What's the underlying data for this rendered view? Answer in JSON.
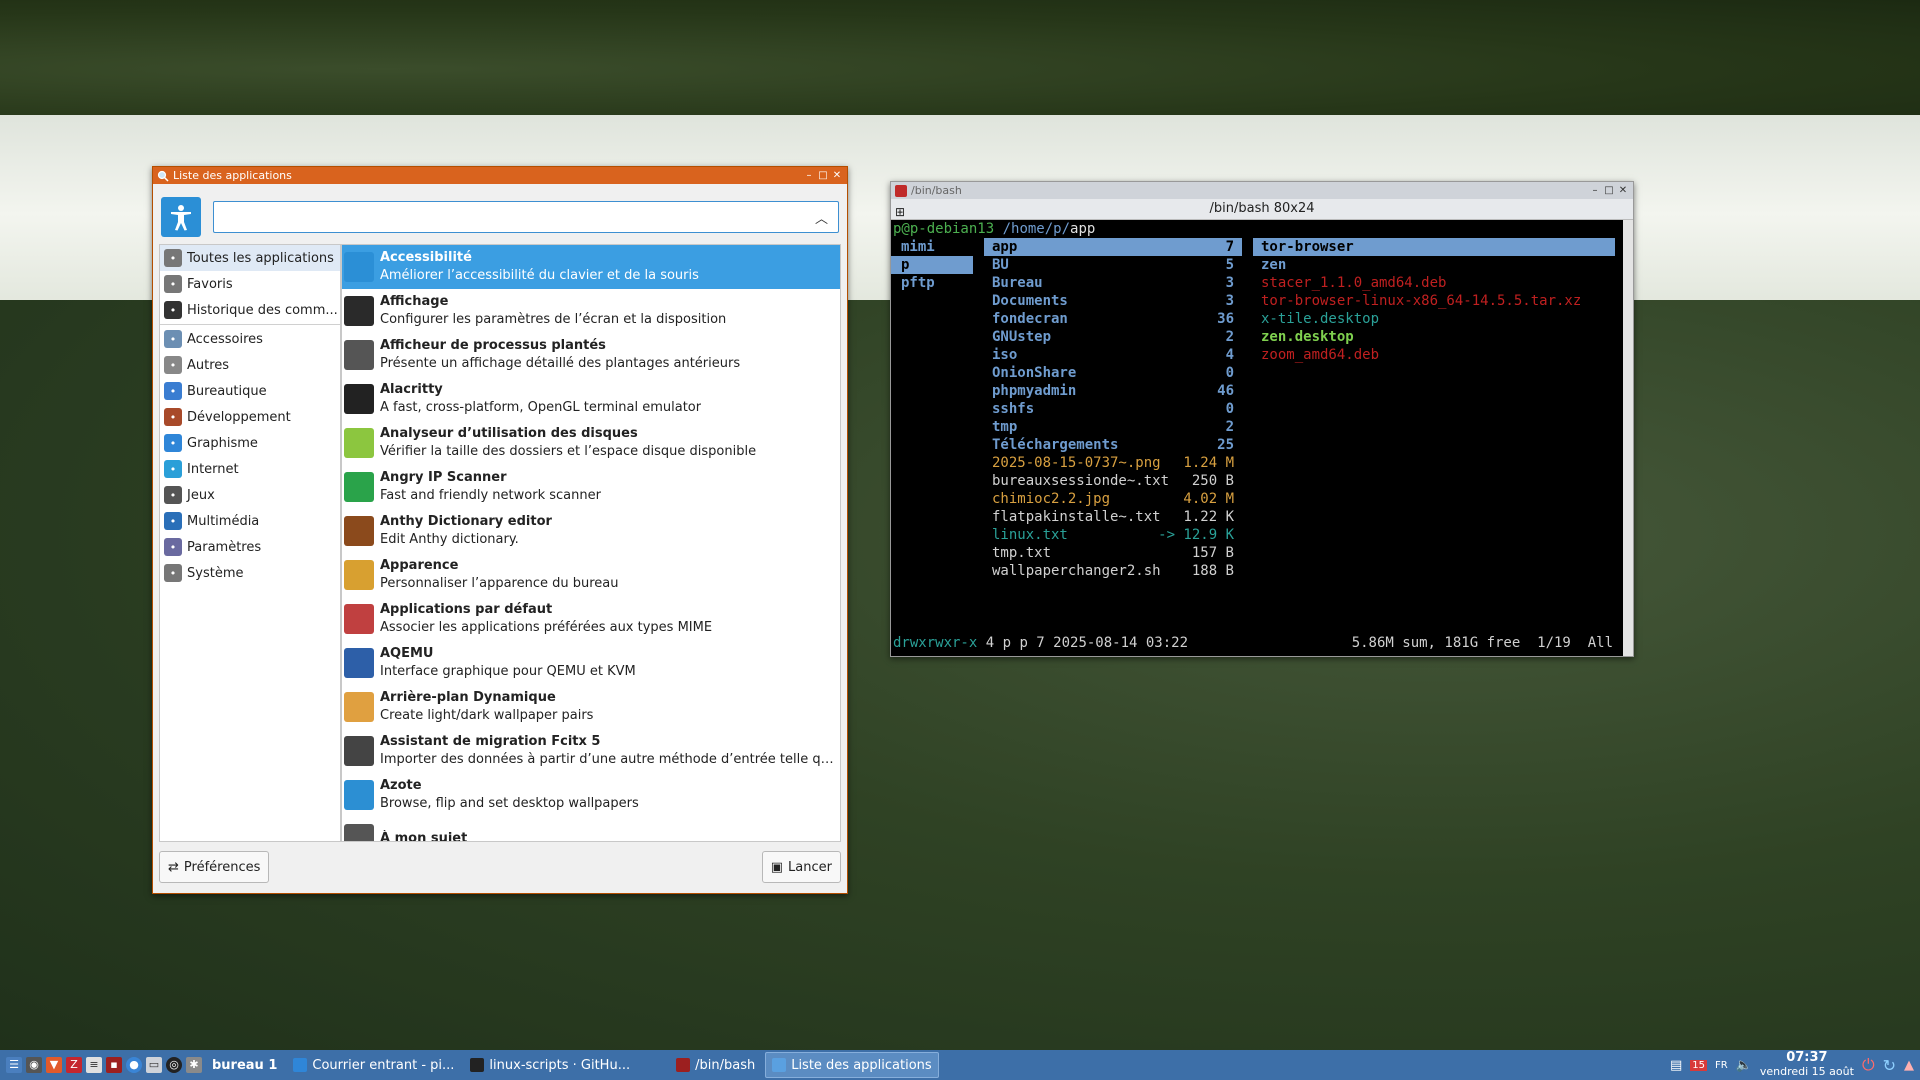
{
  "colors": {
    "accent": "#3b9ee2",
    "titlebar_active": "#d9631e",
    "taskbar": "#3d6fa8",
    "term_green": "#4cb050",
    "term_blue": "#6f9ccf",
    "term_orange": "#d8a040",
    "term_red": "#c02020",
    "term_teal": "#2aa198"
  },
  "applist": {
    "title": "Liste des applications",
    "search_value": "",
    "categories_top": [
      {
        "label": "Toutes les applications",
        "icon": "all-apps-icon"
      },
      {
        "label": "Favoris",
        "icon": "favorites-icon"
      },
      {
        "label": "Historique des comm...",
        "icon": "history-icon"
      }
    ],
    "categories": [
      {
        "label": "Accessoires",
        "icon": "accessories-icon"
      },
      {
        "label": "Autres",
        "icon": "others-icon"
      },
      {
        "label": "Bureautique",
        "icon": "office-icon"
      },
      {
        "label": "Développement",
        "icon": "development-icon"
      },
      {
        "label": "Graphisme",
        "icon": "graphics-icon"
      },
      {
        "label": "Internet",
        "icon": "internet-icon"
      },
      {
        "label": "Jeux",
        "icon": "games-icon"
      },
      {
        "label": "Multimédia",
        "icon": "multimedia-icon"
      },
      {
        "label": "Paramètres",
        "icon": "settings-icon"
      },
      {
        "label": "Système",
        "icon": "system-icon"
      }
    ],
    "apps": [
      {
        "name": "Accessibilité",
        "desc": "Améliorer l’accessibilité du clavier et de la souris",
        "icon": "accessibility-icon"
      },
      {
        "name": "Affichage",
        "desc": "Configurer les paramètres de l’écran et la disposition",
        "icon": "display-icon"
      },
      {
        "name": "Afficheur de processus plantés",
        "desc": "Présente un affichage détaillé des plantages antérieurs",
        "icon": "crash-viewer-icon"
      },
      {
        "name": "Alacritty",
        "desc": "A fast, cross-platform, OpenGL terminal emulator",
        "icon": "alacritty-icon"
      },
      {
        "name": "Analyseur d’utilisation des disques",
        "desc": "Vérifier la taille des dossiers et l’espace disque disponible",
        "icon": "disk-usage-icon"
      },
      {
        "name": "Angry IP Scanner",
        "desc": "Fast and friendly network scanner",
        "icon": "ip-scanner-icon"
      },
      {
        "name": "Anthy Dictionary editor",
        "desc": "Edit Anthy dictionary.",
        "icon": "dictionary-icon"
      },
      {
        "name": "Apparence",
        "desc": "Personnaliser l’apparence du bureau",
        "icon": "appearance-icon"
      },
      {
        "name": "Applications par défaut",
        "desc": "Associer les applications préférées aux types MIME",
        "icon": "default-apps-icon"
      },
      {
        "name": "AQEMU",
        "desc": "Interface graphique pour QEMU et KVM",
        "icon": "aqemu-icon"
      },
      {
        "name": "Arrière-plan Dynamique",
        "desc": "Create light/dark wallpaper pairs",
        "icon": "dynamic-wallpaper-icon"
      },
      {
        "name": "Assistant de migration Fcitx 5",
        "desc": "Importer des données à partir d’une autre méthode d’entrée telle que F...",
        "icon": "fcitx-icon"
      },
      {
        "name": "Azote",
        "desc": "Browse, flip and set desktop wallpapers",
        "icon": "azote-icon"
      },
      {
        "name": "À mon sujet",
        "desc": "",
        "icon": "about-me-icon"
      }
    ],
    "prefs_button": "Préférences",
    "launch_button": "Lancer"
  },
  "terminal": {
    "title": "/bin/bash",
    "subtitle": "/bin/bash 80x24",
    "prompt_user": "p@p-debian13",
    "prompt_path": "/home/p/",
    "prompt_cwd": "app",
    "parent_entries": [
      "mimi",
      "p",
      "pftp"
    ],
    "current_entries": [
      {
        "name": "app",
        "size": "7",
        "kind": "dir"
      },
      {
        "name": "BU",
        "size": "5",
        "kind": "dir"
      },
      {
        "name": "Bureau",
        "size": "3",
        "kind": "dir"
      },
      {
        "name": "Documents",
        "size": "3",
        "kind": "dir"
      },
      {
        "name": "fondecran",
        "size": "36",
        "kind": "dir"
      },
      {
        "name": "GNUstep",
        "size": "2",
        "kind": "dir"
      },
      {
        "name": "iso",
        "size": "4",
        "kind": "dir"
      },
      {
        "name": "OnionShare",
        "size": "0",
        "kind": "dir"
      },
      {
        "name": "phpmyadmin",
        "size": "46",
        "kind": "dir"
      },
      {
        "name": "sshfs",
        "size": "0",
        "kind": "dir"
      },
      {
        "name": "tmp",
        "size": "2",
        "kind": "dir"
      },
      {
        "name": "Téléchargements",
        "size": "25",
        "kind": "dir"
      },
      {
        "name": "2025-08-15-0737~.png",
        "size": "1.24 M",
        "kind": "image"
      },
      {
        "name": "bureauxsessionde~.txt",
        "size": "250 B",
        "kind": "file"
      },
      {
        "name": "chimioc2.2.jpg",
        "size": "4.02 M",
        "kind": "image"
      },
      {
        "name": "flatpakinstalle~.txt",
        "size": "1.22 K",
        "kind": "file"
      },
      {
        "name": "linux.txt",
        "size": "-> 12.9 K",
        "kind": "link"
      },
      {
        "name": "tmp.txt",
        "size": "157 B",
        "kind": "file"
      },
      {
        "name": "wallpaperchanger2.sh",
        "size": "188 B",
        "kind": "file"
      }
    ],
    "preview_entries": [
      {
        "name": "tor-browser",
        "kind": "dir"
      },
      {
        "name": "zen",
        "kind": "dir"
      },
      {
        "name": "stacer_1.1.0_amd64.deb",
        "kind": "archive"
      },
      {
        "name": "tor-browser-linux-x86_64-14.5.5.tar.xz",
        "kind": "archive"
      },
      {
        "name": "x-tile.desktop",
        "kind": "link"
      },
      {
        "name": "zen.desktop",
        "kind": "exec"
      },
      {
        "name": "zoom_amd64.deb",
        "kind": "archive"
      }
    ],
    "status_perms": "drwxrwxr-x",
    "status_info": " 4 p p 7 2025-08-14 03:22",
    "status_right": "5.86M sum, 181G free  1/19  All"
  },
  "taskbar": {
    "desktop_label": "bureau 1",
    "tasks": [
      {
        "label": "Courrier entrant - pi...",
        "icon": "mail-icon"
      },
      {
        "label": "linux-scripts · GitHu...",
        "icon": "github-icon"
      },
      {
        "label": "/bin/bash",
        "icon": "terminal-icon"
      },
      {
        "label": "Liste des applications",
        "icon": "app-list-icon"
      }
    ],
    "clock_time": "07:37",
    "clock_date": "vendredi 15 août",
    "keyboard_layout": "FR"
  }
}
